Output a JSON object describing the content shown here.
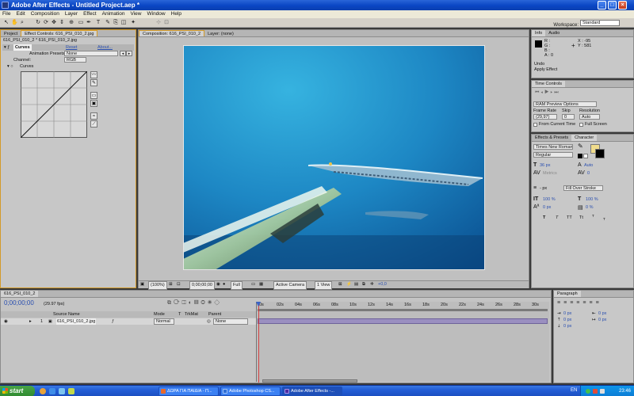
{
  "window": {
    "title": "Adobe After Effects - Untitled Project.aep *",
    "controls": [
      "_",
      "□",
      "×"
    ]
  },
  "menu": [
    "File",
    "Edit",
    "Composition",
    "Layer",
    "Effect",
    "Animation",
    "View",
    "Window",
    "Help"
  ],
  "toolbar": {
    "workspace_label": "Workspace:",
    "workspace_value": "Standard"
  },
  "left_panel": {
    "tabs": [
      "Project",
      "Effect Controls: 616_PSI_010_2.jpg"
    ],
    "breadcrumb": "616_PSI_010_2 * 616_PSI_010_2.jpg",
    "effect_name": "Curves",
    "reset": "Reset",
    "about": "About...",
    "animation_presets_label": "Animation Presets:",
    "animation_presets_value": "None",
    "channel_label": "Channel:",
    "channel_value": "RGB",
    "curves_label": "Curves"
  },
  "composition": {
    "tabs": [
      "Composition: 616_PSI_010_2",
      "Layer: (none)"
    ],
    "footer": {
      "zoom": "(100%)",
      "timecode": "0;00;00;00",
      "resolution": "Full",
      "camera": "Active Camera",
      "views": "1 View",
      "exposure": "+0,0"
    }
  },
  "info": {
    "tabs": [
      "Info",
      "Audio"
    ],
    "r": "R :",
    "g": "G :",
    "b": "B :",
    "a": "A : 0",
    "x": "X : -95",
    "y": "Y : 581",
    "status1": "Undo",
    "status2": "Apply Effect"
  },
  "time_controls": {
    "tab": "Time Controls",
    "ram_preview": "RAM Preview Options",
    "frame_rate_label": "Frame Rate",
    "skip_label": "Skip",
    "resolution_label": "Resolution",
    "frame_rate": "(29,97)",
    "skip": "0",
    "resolution": "Auto",
    "from_current": "From Current Time",
    "full_screen": "Full Screen"
  },
  "character": {
    "tabs": [
      "Effects & Presets",
      "Character"
    ],
    "font": "Times New Roman",
    "style": "Regular",
    "size": "36 px",
    "leading": "Auto",
    "kerning": "Metrics",
    "tracking": "0",
    "stroke": "- px",
    "stroke_type": "Fill Over Stroke",
    "vscale": "100 %",
    "hscale": "100 %",
    "baseline": "0 px",
    "tsume": "0 %",
    "style_buttons": [
      "T",
      "T",
      "TT",
      "Tt",
      "T",
      "T"
    ]
  },
  "timeline": {
    "tab": "616_PSI_010_2",
    "timecode": "0;00;00;00",
    "fps": "(29.97 fps)",
    "headers": {
      "source": "Source Name",
      "mode": "Mode",
      "t": "T",
      "trkmat": "TrkMat",
      "parent": "Parent"
    },
    "layer": {
      "index": "1",
      "name": "616_PSI_010_2.jpg",
      "mode": "Normal",
      "parent": "None"
    },
    "ruler": [
      "0s",
      "02s",
      "04s",
      "06s",
      "08s",
      "10s",
      "12s",
      "14s",
      "16s",
      "18s",
      "20s",
      "22s",
      "24s",
      "26s",
      "28s",
      "30s"
    ]
  },
  "paragraph": {
    "tab": "Paragraph",
    "fields": [
      "0 px",
      "0 px",
      "0 px",
      "0 px",
      "0 px"
    ]
  },
  "taskbar": {
    "start": "start",
    "items": [
      {
        "label": "ΔΩΡΑ ΓΙΑ ΠΑΙΔΙΑ - Π...",
        "color": "#e8692c"
      },
      {
        "label": "Adobe Photoshop CS...",
        "color": "#2f6fd6"
      },
      {
        "label": "Adobe After Effects -...",
        "color": "#4b2ca3"
      }
    ],
    "lang": "EN",
    "clock": "23:46"
  },
  "colors": {
    "accent": "#d39a29",
    "playhead": "#d64040",
    "layer_bar": "#9a8fc0",
    "title_blue": "#0a46c4"
  }
}
